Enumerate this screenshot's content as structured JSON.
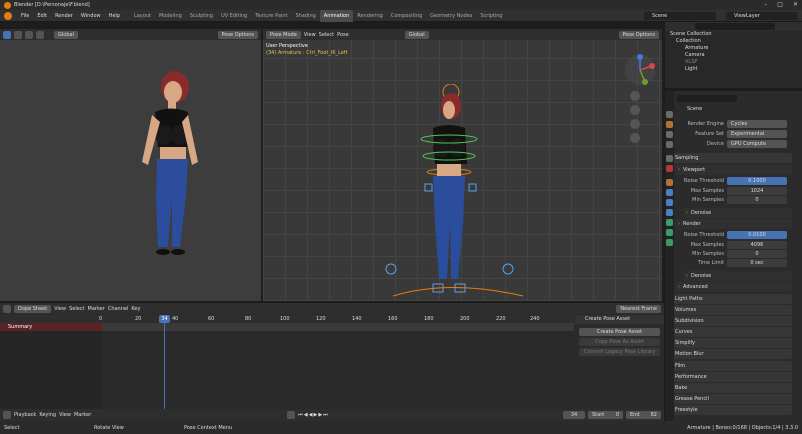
{
  "title_bar": {
    "title": "Blender [D:\\Personaje\\F.blend]"
  },
  "menu": [
    "File",
    "Edit",
    "Render",
    "Window",
    "Help"
  ],
  "workspaces": [
    "Layout",
    "Modeling",
    "Sculpting",
    "UV Editing",
    "Texture Paint",
    "Shading",
    "Animation",
    "Rendering",
    "Compositing",
    "Geometry Nodes",
    "Scripting"
  ],
  "active_workspace": "Animation",
  "scene_name": "Scene",
  "view_layer": "ViewLayer",
  "left_viewport": {
    "mode": "Pose Mode",
    "orientation": "Global",
    "options": "Pose Options"
  },
  "main_viewport": {
    "mode": "Pose Mode",
    "menu": [
      "View",
      "Select",
      "Pose"
    ],
    "orientation": "Global",
    "options": "Pose Options",
    "perspective": "User Perspective",
    "info": "(34) Armature : Ctrl_Foot_IK_Left"
  },
  "outliner": {
    "root": "Scene Collection",
    "items": [
      "Collection",
      "Armature",
      "Camera",
      "VLSP",
      "Light"
    ]
  },
  "properties": {
    "title": "Scene",
    "render_engine_label": "Render Engine",
    "render_engine": "Cycles",
    "feature_set_label": "Feature Set",
    "feature_set": "Experimental",
    "device_label": "Device",
    "device": "GPU Compute",
    "sampling": "Sampling",
    "viewport": "Viewport",
    "noise_threshold_label": "Noise Threshold",
    "vp_noise": "0.1000",
    "max_samples_label": "Max Samples",
    "vp_max": "1024",
    "min_samples_label": "Min Samples",
    "vp_min": "0",
    "denoise": "Denoise",
    "render": "Render",
    "r_noise": "0.0100",
    "r_max": "4096",
    "r_min": "0",
    "time_limit_label": "Time Limit",
    "time_limit": "0 sec",
    "advanced": "Advanced",
    "sections": [
      "Light Paths",
      "Volumes",
      "Subdivision",
      "Curves",
      "Simplify",
      "Motion Blur",
      "Film",
      "Performance",
      "Bake",
      "Grease Pencil",
      "Freestyle"
    ]
  },
  "dope_sheet": {
    "mode": "Dope Sheet",
    "menu": [
      "View",
      "Select",
      "Marker",
      "Channel",
      "Key"
    ],
    "snap": "Nearest Frame",
    "summary": "Summary",
    "current_frame": "34",
    "ticks": [
      "0",
      "20",
      "40",
      "60",
      "80",
      "100",
      "120",
      "140",
      "160",
      "180",
      "200",
      "220",
      "240"
    ]
  },
  "pose_library": {
    "header": "Create Pose Asset",
    "create": "Create Pose Asset",
    "copy": "Copy Pose As Asset",
    "convert": "Convert Legacy Pose Library"
  },
  "timeline": {
    "menu": [
      "Playback",
      "Keying",
      "View",
      "Marker"
    ],
    "frame": "34",
    "start_label": "Start",
    "start": "0",
    "end_label": "End",
    "end": "82"
  },
  "status": {
    "select": "Select",
    "rotate": "Rotate View",
    "context": "Pose Context Menu",
    "info": "Armature | Bones:0/168 | Objects:1/4 | 3.3.0"
  },
  "colors": {
    "accent": "#4772b3",
    "orange": "#e87d0d"
  }
}
